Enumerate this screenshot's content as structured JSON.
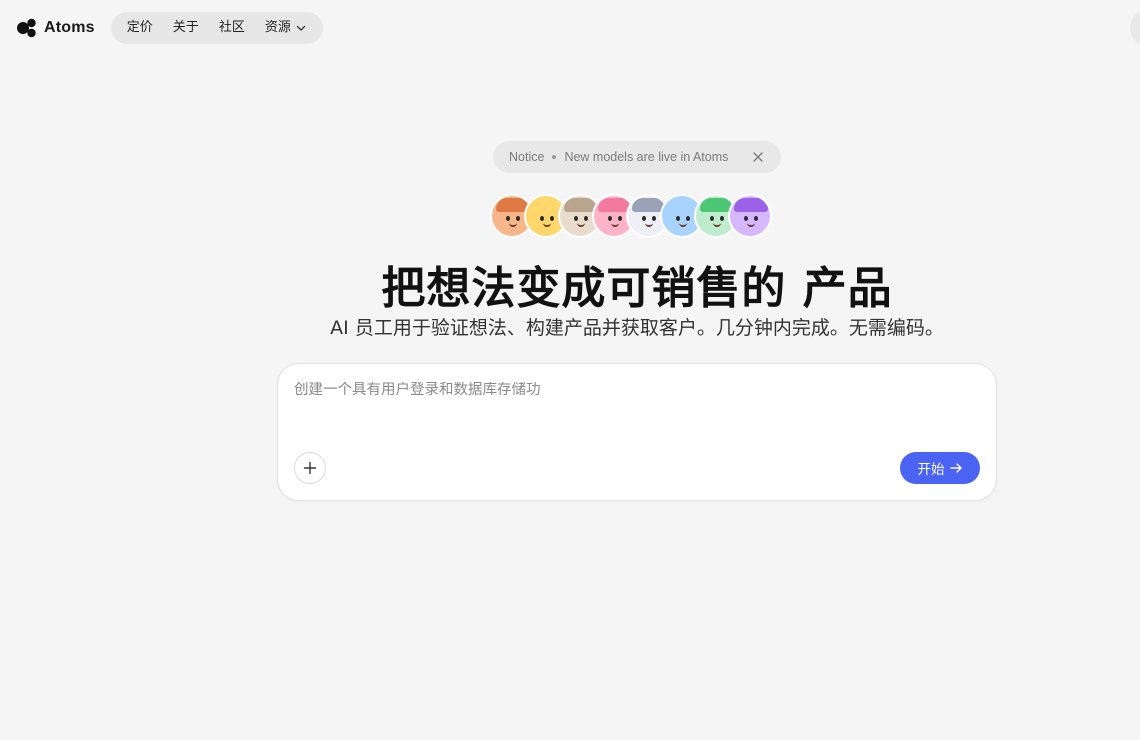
{
  "brand": {
    "name": "Atoms"
  },
  "nav": {
    "items": [
      {
        "label": "定价"
      },
      {
        "label": "关于"
      },
      {
        "label": "社区"
      },
      {
        "label": "资源",
        "has_dropdown": true
      }
    ]
  },
  "notice": {
    "label": "Notice",
    "message": "New models are live in Atoms",
    "icon": "close-icon"
  },
  "hero": {
    "title": "把想法变成可销售的 产品",
    "subtitle": "AI 员工用于验证想法、构建产品并获取客户。几分钟内完成。无需编码。"
  },
  "prompt": {
    "placeholder": "创建一个具有用户登录和数据库存储功",
    "value": "",
    "attach_icon": "plus-icon",
    "start_label": "开始",
    "start_icon": "arrow-right-icon"
  },
  "colors": {
    "background": "#f5f5f5",
    "accent": "#4b63f3",
    "nav_pill": "#e7e7e7",
    "notice_bg": "#e8e8e8"
  }
}
